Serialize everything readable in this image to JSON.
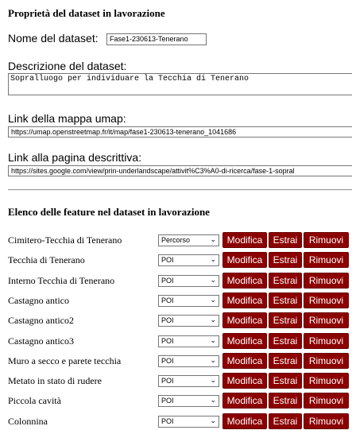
{
  "section1": {
    "title": "Proprietà del dataset in lavorazione",
    "name_label": "Nome del dataset:",
    "name_value": "Fase1-230613-Tenerano",
    "desc_label": "Descrizione del dataset:",
    "desc_value": "Sopralluogo per individuare la Tecchia di Tenerano",
    "umap_label": "Link della mappa umap:",
    "umap_value": "https://umap.openstreetmap.fr/it/map/fase1-230613-tenerano_1041686",
    "page_label": "Link alla pagina descrittiva:",
    "page_value": "https://sites.google.com/view/prin-underlandscape/attivit%C3%A0-di-ricerca/fase-1-sopral"
  },
  "section2": {
    "title": "Elenco delle feature nel dataset in lavorazione",
    "buttons": {
      "edit": "Modifica",
      "extract": "Estrai",
      "remove": "Rimuovi"
    },
    "features": [
      {
        "name": "Cimitero-Tecchia di Tenerano",
        "type": "Percorso"
      },
      {
        "name": "Tecchia di Tenerano",
        "type": "POI"
      },
      {
        "name": "Interno Tecchia di Tenerano",
        "type": "POI"
      },
      {
        "name": "Castagno antico",
        "type": "POI"
      },
      {
        "name": "Castagno antico2",
        "type": "POI"
      },
      {
        "name": "Castagno antico3",
        "type": "POI"
      },
      {
        "name": "Muro a secco e parete tecchia",
        "type": "POI"
      },
      {
        "name": "Metato in stato di rudere",
        "type": "POI"
      },
      {
        "name": "Piccola cavità",
        "type": "POI"
      },
      {
        "name": "Colonnina",
        "type": "POI"
      }
    ]
  },
  "colors": {
    "button_bg": "#8b0000",
    "button_text": "#ffffff"
  },
  "icons": {
    "select_arrow": "chevron-down-icon"
  }
}
